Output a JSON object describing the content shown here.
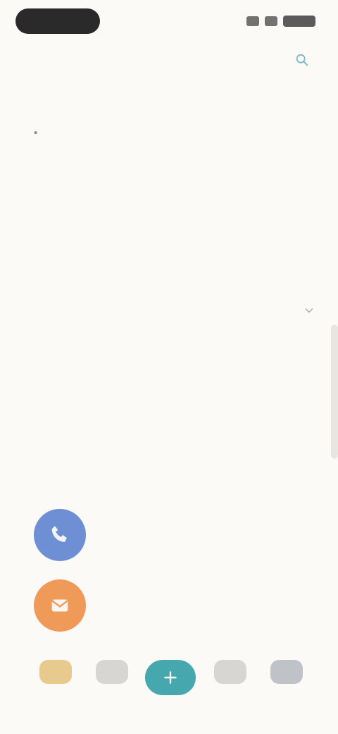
{
  "status_bar": {
    "time": "",
    "battery": ""
  },
  "header": {
    "title": "",
    "action_icon": "search-icon"
  },
  "info_section": {
    "title": "",
    "bullets": [
      "",
      ""
    ]
  },
  "faq_row": {
    "label": "",
    "chevron_icon": "chevron-down-icon"
  },
  "share_section": {
    "title": "",
    "description": "",
    "items": [
      {
        "label": "",
        "value": "",
        "icon": "phone-icon",
        "color": "#6f8fd4",
        "text_color": "#6f8fd4"
      },
      {
        "label": "",
        "value": "",
        "icon": "mail-icon",
        "color": "#f09a5a",
        "text_color": "#f09a5a"
      }
    ]
  },
  "tab_bar": {
    "tabs": [
      {
        "label": "",
        "icon": "home-icon",
        "color": "#e8ca8f"
      },
      {
        "label": "",
        "icon": "list-icon",
        "color": "#d8d6d2"
      },
      {
        "label": "",
        "icon": "add-icon",
        "color": "#46a8ae"
      },
      {
        "label": "",
        "icon": "calendar-icon",
        "color": "#d8d6d2"
      },
      {
        "label": "",
        "icon": "profile-icon",
        "color": "#bfc3c8"
      }
    ]
  }
}
